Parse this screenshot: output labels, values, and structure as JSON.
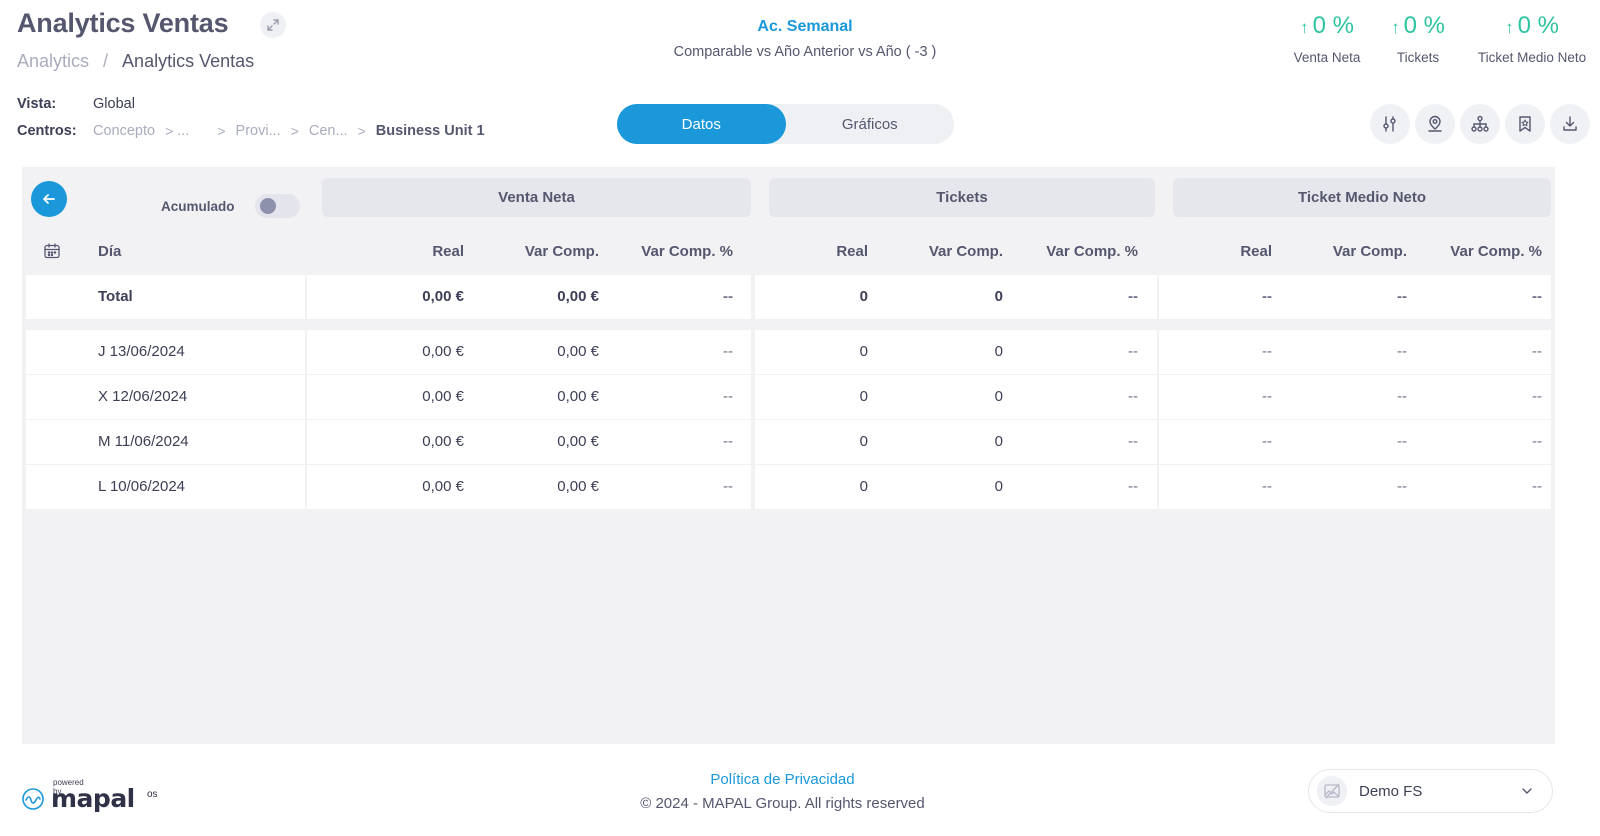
{
  "header": {
    "title": "Analytics Ventas",
    "breadcrumb": {
      "parent": "Analytics",
      "separator": "/",
      "current": "Analytics Ventas"
    },
    "period": {
      "title": "Ac. Semanal",
      "subtitle": "Comparable vs Año Anterior vs Año ( -3 )"
    },
    "kpis": [
      {
        "value": "0 %",
        "label": "Venta Neta",
        "trend": "up"
      },
      {
        "value": "0 %",
        "label": "Tickets",
        "trend": "up"
      },
      {
        "value": "0 %",
        "label": "Ticket Medio Neto",
        "trend": "up"
      }
    ]
  },
  "filters": {
    "vista_label": "Vista:",
    "vista_value": "Global",
    "centros_label": "Centros:",
    "centros_path": [
      "Concepto",
      "...",
      "Provi...",
      "Cen...",
      "Business Unit 1"
    ]
  },
  "view_toggle": {
    "datos": "Datos",
    "graficos": "Gráficos",
    "active": "Datos"
  },
  "toolbar": {
    "icons": [
      "sliders-icon",
      "location-pin-icon",
      "hierarchy-icon",
      "bookmark-star-icon",
      "download-icon"
    ]
  },
  "table": {
    "acumulado_label": "Acumulado",
    "acumulado_on": false,
    "groups": [
      "Venta Neta",
      "Tickets",
      "Ticket Medio Neto"
    ],
    "columns": {
      "day": "Día",
      "sub": [
        "Real",
        "Var Comp.",
        "Var Comp. %",
        "Real",
        "Var Comp.",
        "Var Comp. %",
        "Real",
        "Var Comp.",
        "Var Comp. %"
      ]
    },
    "total": {
      "label": "Total",
      "values": [
        "0,00 €",
        "0,00 €",
        "--",
        "0",
        "0",
        "--",
        "--",
        "--",
        "--"
      ]
    },
    "rows": [
      {
        "day": "J 13/06/2024",
        "values": [
          "0,00 €",
          "0,00 €",
          "--",
          "0",
          "0",
          "--",
          "--",
          "--",
          "--"
        ]
      },
      {
        "day": "X 12/06/2024",
        "values": [
          "0,00 €",
          "0,00 €",
          "--",
          "0",
          "0",
          "--",
          "--",
          "--",
          "--"
        ]
      },
      {
        "day": "M 11/06/2024",
        "values": [
          "0,00 €",
          "0,00 €",
          "--",
          "0",
          "0",
          "--",
          "--",
          "--",
          "--"
        ]
      },
      {
        "day": "L 10/06/2024",
        "values": [
          "0,00 €",
          "0,00 €",
          "--",
          "0",
          "0",
          "--",
          "--",
          "--",
          "--"
        ]
      }
    ]
  },
  "footer": {
    "logo_powered": "powered by",
    "logo_name": "mapal",
    "logo_suffix": "os",
    "privacy": "Política de Privacidad",
    "copyright": "© 2024 - MAPAL Group. All rights reserved",
    "account_name": "Demo FS"
  },
  "colors": {
    "accent": "#1a98d9",
    "positive": "#2ec4a0",
    "panel_bg": "#f2f2f5"
  }
}
